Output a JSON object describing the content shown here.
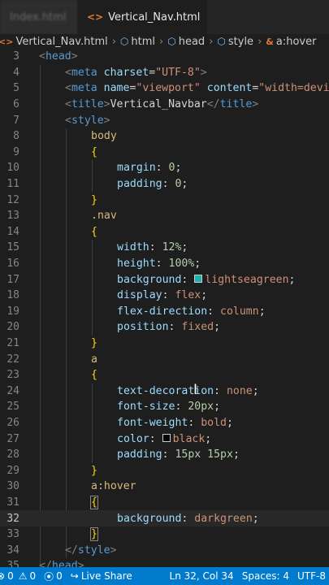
{
  "tabs": [
    {
      "label": "Index.html",
      "active": false
    },
    {
      "label": "Vertical_Nav.html",
      "active": true,
      "modified": true
    }
  ],
  "breadcrumb": [
    {
      "label": "Vertical_Nav.html",
      "icon": "html-file-icon"
    },
    {
      "label": "html",
      "icon": "element-icon"
    },
    {
      "label": "head",
      "icon": "element-icon"
    },
    {
      "label": "style",
      "icon": "element-icon"
    },
    {
      "label": "a:hover",
      "icon": "selector-icon"
    }
  ],
  "editor": {
    "current_line": 32,
    "lines": [
      {
        "n": "3",
        "indent": 0,
        "parts": [
          [
            "br",
            "<"
          ],
          [
            "tag",
            "head"
          ],
          [
            "br",
            ">"
          ]
        ]
      },
      {
        "n": "4",
        "indent": 1,
        "parts": [
          [
            "br",
            "<"
          ],
          [
            "tag",
            "meta"
          ],
          [
            "text",
            " "
          ],
          [
            "attr",
            "charset"
          ],
          [
            "text",
            "="
          ],
          [
            "str",
            "\"UTF-8\""
          ],
          [
            "br",
            ">"
          ]
        ]
      },
      {
        "n": "5",
        "indent": 1,
        "parts": [
          [
            "br",
            "<"
          ],
          [
            "tag",
            "meta"
          ],
          [
            "text",
            " "
          ],
          [
            "attr",
            "name"
          ],
          [
            "text",
            "="
          ],
          [
            "str",
            "\"viewport\""
          ],
          [
            "text",
            " "
          ],
          [
            "attr",
            "content"
          ],
          [
            "text",
            "="
          ],
          [
            "str",
            "\"width=devi"
          ]
        ]
      },
      {
        "n": "6",
        "indent": 1,
        "parts": [
          [
            "br",
            "<"
          ],
          [
            "tag",
            "title"
          ],
          [
            "br",
            ">"
          ],
          [
            "text",
            "Vertical_Navbar"
          ],
          [
            "br",
            "</"
          ],
          [
            "tag",
            "title"
          ],
          [
            "br",
            ">"
          ]
        ]
      },
      {
        "n": "7",
        "indent": 1,
        "parts": [
          [
            "br",
            "<"
          ],
          [
            "tag",
            "style"
          ],
          [
            "br",
            ">"
          ]
        ]
      },
      {
        "n": "8",
        "indent": 2,
        "parts": [
          [
            "sel",
            "body"
          ]
        ]
      },
      {
        "n": "9",
        "indent": 2,
        "parts": [
          [
            "brace",
            "{"
          ]
        ]
      },
      {
        "n": "10",
        "indent": 3,
        "parts": [
          [
            "prop",
            "margin"
          ],
          [
            "text",
            ": "
          ],
          [
            "num",
            "0"
          ],
          [
            "text",
            ";"
          ]
        ]
      },
      {
        "n": "11",
        "indent": 3,
        "parts": [
          [
            "prop",
            "padding"
          ],
          [
            "text",
            ": "
          ],
          [
            "num",
            "0"
          ],
          [
            "text",
            ";"
          ]
        ]
      },
      {
        "n": "12",
        "indent": 2,
        "parts": [
          [
            "brace",
            "}"
          ]
        ]
      },
      {
        "n": "13",
        "indent": 2,
        "parts": [
          [
            "sel",
            ".nav"
          ]
        ]
      },
      {
        "n": "14",
        "indent": 2,
        "parts": [
          [
            "brace",
            "{"
          ]
        ]
      },
      {
        "n": "15",
        "indent": 3,
        "parts": [
          [
            "prop",
            "width"
          ],
          [
            "text",
            ": "
          ],
          [
            "num",
            "12%"
          ],
          [
            "text",
            ";"
          ]
        ]
      },
      {
        "n": "16",
        "indent": 3,
        "parts": [
          [
            "prop",
            "height"
          ],
          [
            "text",
            ": "
          ],
          [
            "num",
            "100%"
          ],
          [
            "text",
            ";"
          ]
        ]
      },
      {
        "n": "17",
        "indent": 3,
        "parts": [
          [
            "prop",
            "background"
          ],
          [
            "text",
            ": "
          ],
          [
            "swatch",
            "#20b2aa"
          ],
          [
            "val",
            "lightseagreen"
          ],
          [
            "text",
            ";"
          ]
        ]
      },
      {
        "n": "18",
        "indent": 3,
        "parts": [
          [
            "prop",
            "display"
          ],
          [
            "text",
            ": "
          ],
          [
            "val",
            "flex"
          ],
          [
            "text",
            ";"
          ]
        ]
      },
      {
        "n": "19",
        "indent": 3,
        "parts": [
          [
            "prop",
            "flex-direction"
          ],
          [
            "text",
            ": "
          ],
          [
            "val",
            "column"
          ],
          [
            "text",
            ";"
          ]
        ]
      },
      {
        "n": "20",
        "indent": 3,
        "parts": [
          [
            "prop",
            "position"
          ],
          [
            "text",
            ": "
          ],
          [
            "val",
            "fixed"
          ],
          [
            "text",
            ";"
          ]
        ]
      },
      {
        "n": "21",
        "indent": 2,
        "parts": [
          [
            "brace",
            "}"
          ]
        ]
      },
      {
        "n": "22",
        "indent": 2,
        "parts": [
          [
            "sel",
            "a"
          ]
        ]
      },
      {
        "n": "23",
        "indent": 2,
        "parts": [
          [
            "brace",
            "{"
          ]
        ]
      },
      {
        "n": "24",
        "indent": 3,
        "parts": [
          [
            "prop",
            "text-decoration"
          ],
          [
            "text",
            ": "
          ],
          [
            "val",
            "none"
          ],
          [
            "text",
            ";"
          ]
        ]
      },
      {
        "n": "25",
        "indent": 3,
        "parts": [
          [
            "prop",
            "font-size"
          ],
          [
            "text",
            ": "
          ],
          [
            "num",
            "20px"
          ],
          [
            "text",
            ";"
          ]
        ]
      },
      {
        "n": "26",
        "indent": 3,
        "parts": [
          [
            "prop",
            "font-weight"
          ],
          [
            "text",
            ": "
          ],
          [
            "val",
            "bold"
          ],
          [
            "text",
            ";"
          ]
        ]
      },
      {
        "n": "27",
        "indent": 3,
        "parts": [
          [
            "prop",
            "color"
          ],
          [
            "text",
            ": "
          ],
          [
            "swatch",
            "#000000"
          ],
          [
            "val",
            "black"
          ],
          [
            "text",
            ";"
          ]
        ]
      },
      {
        "n": "28",
        "indent": 3,
        "parts": [
          [
            "prop",
            "padding"
          ],
          [
            "text",
            ": "
          ],
          [
            "num",
            "15px 15px"
          ],
          [
            "text",
            ";"
          ]
        ]
      },
      {
        "n": "29",
        "indent": 2,
        "parts": [
          [
            "brace",
            "}"
          ]
        ]
      },
      {
        "n": "30",
        "indent": 2,
        "parts": [
          [
            "sel",
            "a:hover"
          ]
        ]
      },
      {
        "n": "31",
        "indent": 2,
        "parts": [
          [
            "brace",
            "{"
          ]
        ]
      },
      {
        "n": "32",
        "indent": 3,
        "parts": [
          [
            "prop",
            "background"
          ],
          [
            "text",
            ": "
          ],
          [
            "val",
            "darkgreen"
          ],
          [
            "text",
            ";"
          ]
        ]
      },
      {
        "n": "33",
        "indent": 2,
        "parts": [
          [
            "brace",
            "}"
          ]
        ]
      },
      {
        "n": "34",
        "indent": 1,
        "parts": [
          [
            "br",
            "</"
          ],
          [
            "tag",
            "style"
          ],
          [
            "br",
            ">"
          ]
        ]
      },
      {
        "n": "35",
        "indent": 0,
        "parts": [
          [
            "br",
            "</"
          ],
          [
            "tag",
            "head"
          ],
          [
            "br",
            ">"
          ]
        ]
      }
    ]
  },
  "status": {
    "errors": "0",
    "warnings": "0",
    "remote_count": "0",
    "live_share": "Live Share",
    "position": "Ln 32, Col 34",
    "spaces": "Spaces: 4",
    "encoding": "UTF-8"
  },
  "colors": {
    "accent": "#007acc",
    "editor_bg": "#1e1e1e",
    "lightseagreen": "#20b2aa"
  }
}
